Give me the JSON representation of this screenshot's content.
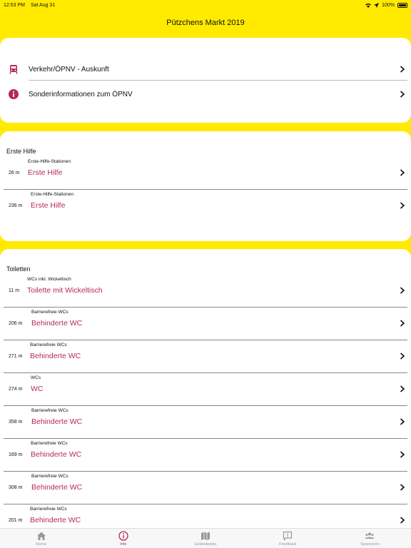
{
  "status_bar": {
    "time": "12:53 PM",
    "date": "Sat Aug 31",
    "battery": "100%"
  },
  "nav": {
    "title": "Pützchens Markt 2019"
  },
  "transport": {
    "items": [
      {
        "label": "Verkehr/ÖPNV - Auskunft",
        "icon": "train-icon"
      },
      {
        "label": "Sonderinformationen zum ÖPNV",
        "icon": "info-icon"
      }
    ]
  },
  "first_aid": {
    "title": "Erste Hilfe",
    "items": [
      {
        "distance": "26 m",
        "category": "Erste-Hilfe-Stationen",
        "name": "Erste Hilfe"
      },
      {
        "distance": "236 m",
        "category": "Erste-Hilfe-Stationen",
        "name": "Erste Hilfe"
      }
    ]
  },
  "toilets": {
    "title": "Toiletten",
    "items": [
      {
        "distance": "11 m",
        "category": "WCs inkl. Wickeltisch",
        "name": "Toilette mit Wickeltisch"
      },
      {
        "distance": "206 m",
        "category": "Barrierefreie WCs",
        "name": "Behinderte WC"
      },
      {
        "distance": "271 m",
        "category": "Barrierefreie WCs",
        "name": "Behinderte WC"
      },
      {
        "distance": "274 m",
        "category": "WCs",
        "name": "WC"
      },
      {
        "distance": "358 m",
        "category": "Barrierefreie WCs",
        "name": "Behinderte WC"
      },
      {
        "distance": "169 m",
        "category": "Barrierefreie WCs",
        "name": "Behinderte WC"
      },
      {
        "distance": "308 m",
        "category": "Barrierefreie WCs",
        "name": "Behinderte WC"
      },
      {
        "distance": "201 m",
        "category": "Barrierefreie WCs",
        "name": "Behinderte WC"
      }
    ]
  },
  "tabbar": {
    "tabs": [
      {
        "label": "Home",
        "icon": "home-icon",
        "active": false
      },
      {
        "label": "Info",
        "icon": "info-icon",
        "active": true
      },
      {
        "label": "Geländeplan",
        "icon": "map-icon",
        "active": false
      },
      {
        "label": "Feedback",
        "icon": "feedback-icon",
        "active": false
      },
      {
        "label": "Sponsoren",
        "icon": "people-icon",
        "active": false
      }
    ]
  },
  "colors": {
    "background": "#ffea00",
    "accent": "#b5285a",
    "inactive": "#999999"
  }
}
